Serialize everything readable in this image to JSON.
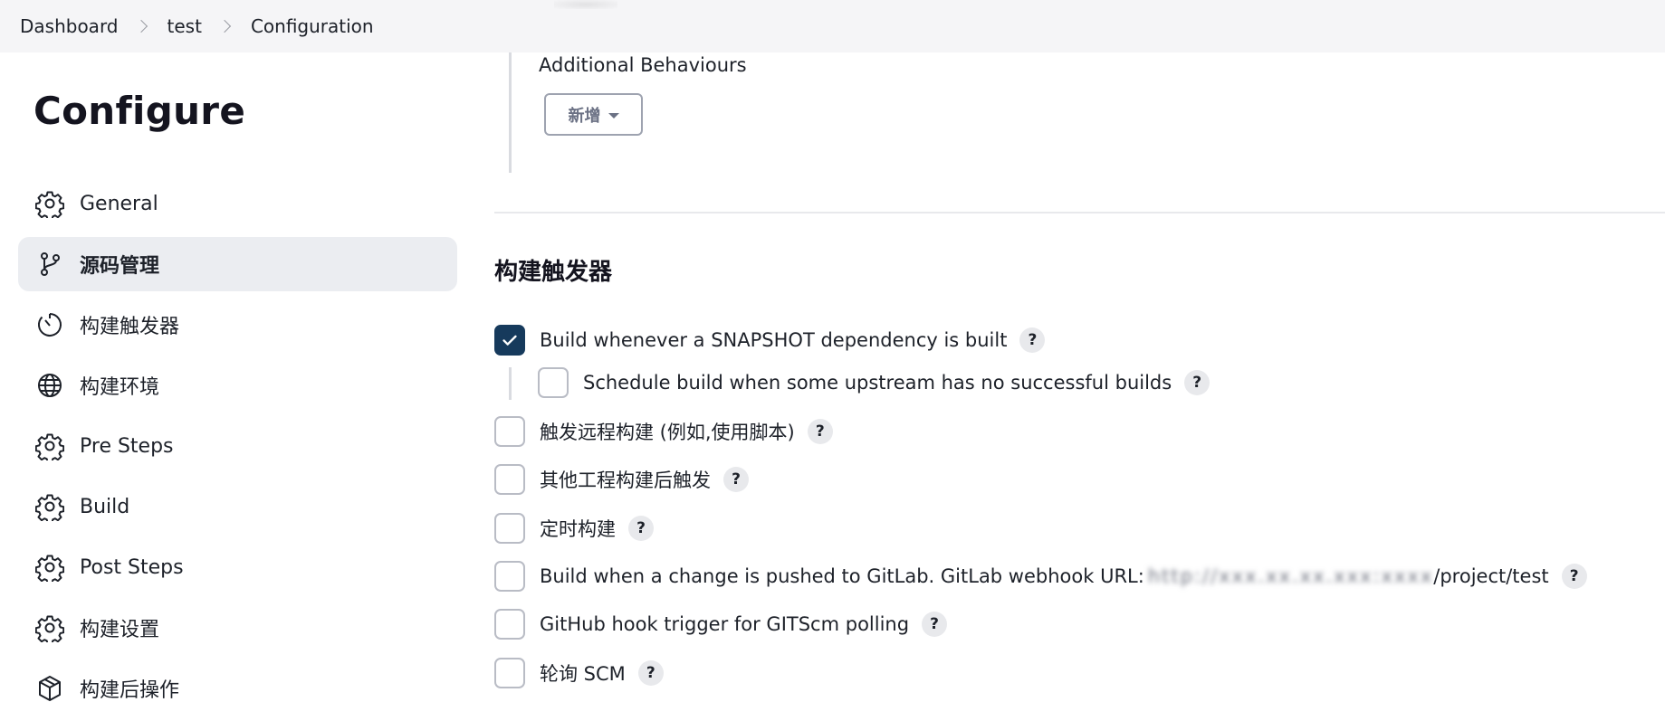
{
  "breadcrumb": {
    "items": [
      "Dashboard",
      "test",
      "Configuration"
    ]
  },
  "sidebar": {
    "title": "Configure",
    "items": [
      {
        "label": "General",
        "icon": "gear-icon"
      },
      {
        "label": "源码管理",
        "icon": "git-branch-icon",
        "active": true
      },
      {
        "label": "构建触发器",
        "icon": "timer-icon"
      },
      {
        "label": "构建环境",
        "icon": "globe-icon"
      },
      {
        "label": "Pre Steps",
        "icon": "gear-icon"
      },
      {
        "label": "Build",
        "icon": "gear-icon"
      },
      {
        "label": "Post Steps",
        "icon": "gear-icon"
      },
      {
        "label": "构建设置",
        "icon": "gear-icon"
      },
      {
        "label": "构建后操作",
        "icon": "package-icon"
      }
    ]
  },
  "scm": {
    "additional_behaviours_label": "Additional Behaviours",
    "add_button_label": "新增"
  },
  "triggers": {
    "title": "构建触发器",
    "help_label": "?",
    "options": [
      {
        "label": "Build whenever a SNAPSHOT dependency is built",
        "checked": true
      },
      {
        "label": "Schedule build when some upstream has no successful builds",
        "checked": false
      },
      {
        "label": "触发远程构建 (例如,使用脚本)",
        "checked": false
      },
      {
        "label": "其他工程构建后触发",
        "checked": false
      },
      {
        "label": "定时构建",
        "checked": false
      },
      {
        "label": "Build when a change is pushed to GitLab. GitLab webhook URL:",
        "url_redacted": "http://xxx.xx.xx.xxx:xxxx",
        "url_suffix": "/project/test",
        "checked": false
      },
      {
        "label": "GitHub hook trigger for GITScm polling",
        "checked": false
      },
      {
        "label": "轮询 SCM",
        "checked": false
      }
    ]
  },
  "colors": {
    "checkbox_checked": "#163a5c",
    "active_nav_bg": "#ebedf1",
    "breadcrumb_bg": "#f5f5f7"
  }
}
